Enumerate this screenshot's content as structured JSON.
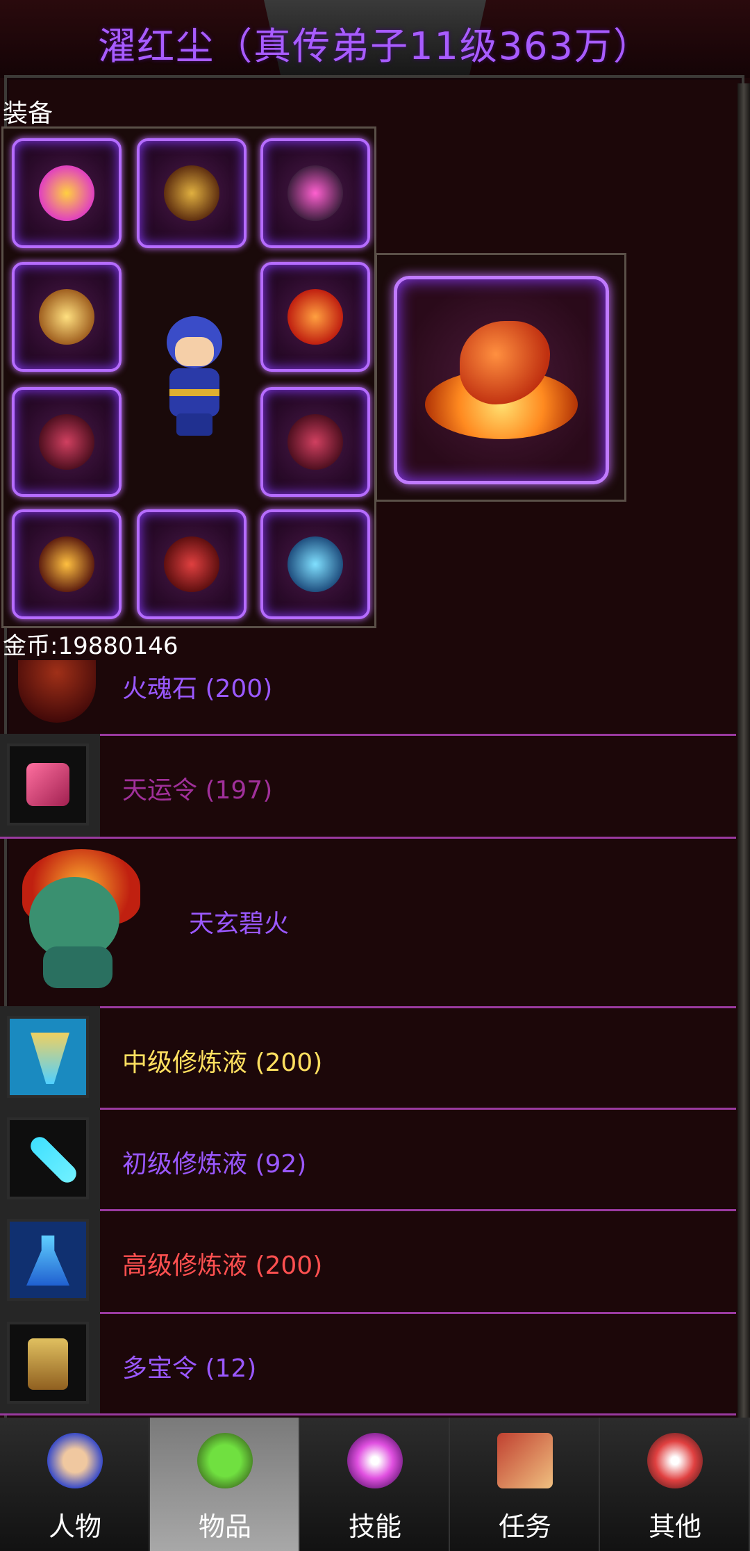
{
  "header": {
    "title": "濯红尘（真传弟子11级363万）"
  },
  "equipment": {
    "section_label": "装备",
    "slots": [
      {
        "name": "helmet-slot",
        "icon": "crown-icon",
        "color": "#e040c0"
      },
      {
        "name": "armor-slot",
        "icon": "armor-icon",
        "color": "#b08030"
      },
      {
        "name": "amulet-slot",
        "icon": "orb-icon",
        "color": "#ff40c0"
      },
      {
        "name": "weapon-slot",
        "icon": "sword-icon",
        "color": "#e0a040"
      },
      {
        "name": "offhand-slot",
        "icon": "flame-sword-icon",
        "color": "#ff4020"
      },
      {
        "name": "ring-left-slot",
        "icon": "ring-icon",
        "color": "#a03050"
      },
      {
        "name": "ring-right-slot",
        "icon": "ring-icon",
        "color": "#a03050"
      },
      {
        "name": "belt-slot",
        "icon": "claw-icon",
        "color": "#c09020"
      },
      {
        "name": "boots-slot",
        "icon": "boots-icon",
        "color": "#c03030"
      },
      {
        "name": "mount-slot",
        "icon": "dragon-icon",
        "color": "#40a0c0"
      }
    ],
    "wing_icon": "fire-wing-icon"
  },
  "gold": {
    "label": "金币:19880146"
  },
  "items": [
    {
      "name": "火魂石 (200)",
      "color": "#9a58ff",
      "icon": "fire-soul-stone-icon"
    },
    {
      "name": "天运令 (197)",
      "color": "#a0309a",
      "icon": "fortune-token-icon"
    },
    {
      "name": "天玄碧火",
      "color": "#9a58ff",
      "icon": "pet-qilin-icon"
    },
    {
      "name": "中级修炼液 (200)",
      "color": "#ffe060",
      "icon": "mid-potion-icon"
    },
    {
      "name": "初级修炼液 (92)",
      "color": "#9a58ff",
      "icon": "low-potion-icon"
    },
    {
      "name": "高级修炼液 (200)",
      "color": "#ff5050",
      "icon": "high-potion-icon"
    },
    {
      "name": "多宝令 (12)",
      "color": "#9a58ff",
      "icon": "treasure-token-icon"
    }
  ],
  "nav": {
    "tabs": [
      {
        "label": "人物",
        "icon": "character-icon",
        "active": false
      },
      {
        "label": "物品",
        "icon": "potion-icon",
        "active": true
      },
      {
        "label": "技能",
        "icon": "skill-icon",
        "active": false
      },
      {
        "label": "任务",
        "icon": "quest-icon",
        "active": false
      },
      {
        "label": "其他",
        "icon": "other-icon",
        "active": false
      }
    ]
  }
}
